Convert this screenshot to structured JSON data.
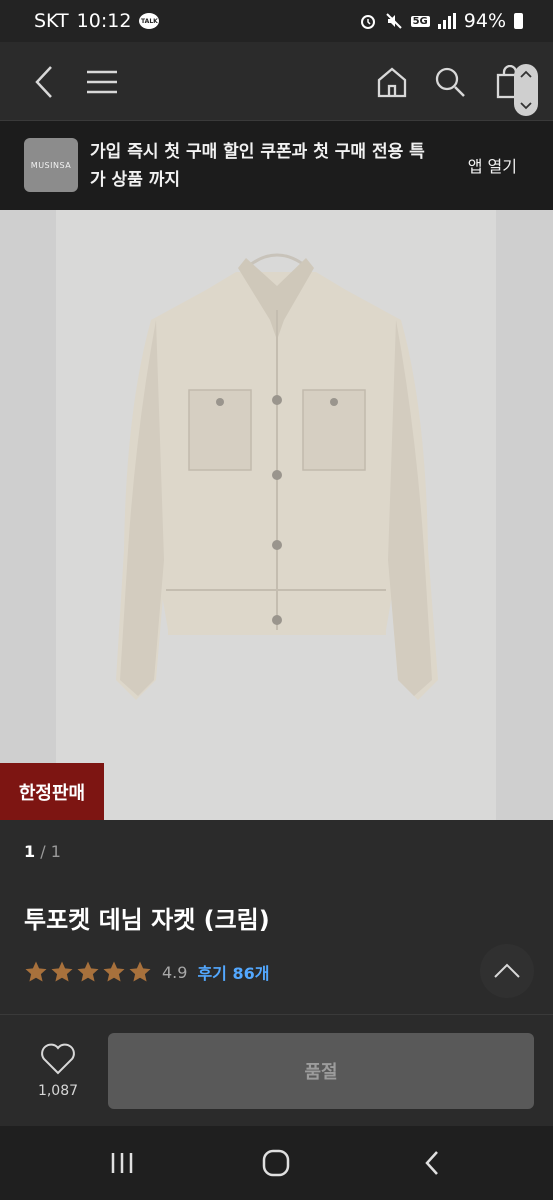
{
  "status_bar": {
    "carrier": "SKT",
    "time": "10:12",
    "talk_badge": "TALK",
    "network": "5G",
    "battery": "94%"
  },
  "nav": {
    "icons": [
      "back-icon",
      "menu-icon",
      "home-icon",
      "search-icon",
      "bag-icon"
    ]
  },
  "banner": {
    "logo_text": "MUSINSA",
    "message": "가입 즉시 첫 구매 할인 쿠폰과 첫 구매 전용 특가 상품 까지",
    "open_app_label": "앱 열기"
  },
  "product": {
    "limited_badge": "한정판매",
    "pager_current": "1",
    "pager_separator": "/",
    "pager_total": "1",
    "title": "투포켓 데님 자켓 (크림)",
    "rating_score": "4.9",
    "review_label": "후기 86개",
    "stars": 5
  },
  "footer": {
    "like_count": "1,087",
    "soldout_label": "품절"
  },
  "colors": {
    "accent_badge": "#7d1512",
    "review_link": "#53a8ff",
    "star": "#a8713c"
  }
}
